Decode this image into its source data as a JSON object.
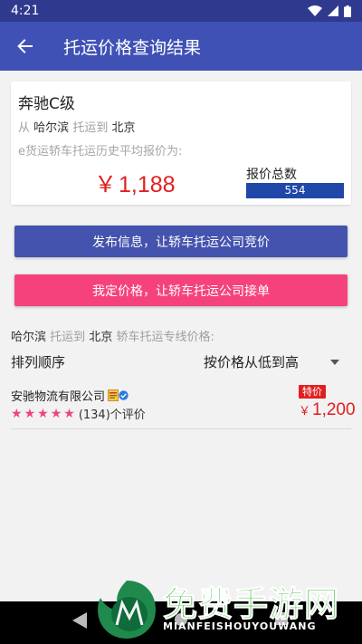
{
  "status_bar": {
    "time": "4:21"
  },
  "app_bar": {
    "title": "托运价格查询结果"
  },
  "summary": {
    "car_name": "奔驰C级",
    "from_prefix": "从",
    "from_city": "哈尔滨",
    "to_mid": "托运到",
    "to_city": "北京",
    "history_label": "e货运轿车托运历史平均报价为:",
    "currency": "￥",
    "avg_price": "1,188",
    "total_label": "报价总数",
    "total_count": "554"
  },
  "actions": {
    "publish_label": "发布信息，让轿车托运公司竞价",
    "fixed_label": "我定价格，让轿车托运公司接单"
  },
  "line_section": {
    "from_city": "哈尔滨",
    "mid": "托运到",
    "to_city": "北京",
    "suffix": "轿车托运专线价格:"
  },
  "sort": {
    "label": "排列顺序",
    "selected": "按价格从低到高"
  },
  "companies": [
    {
      "name": "安驰物流有限公司",
      "stars": 5,
      "reviews": "(134)个评价",
      "tag": "特价",
      "currency": "￥",
      "price": "1,200"
    }
  ],
  "watermark": {
    "title": "免费手游网",
    "subtitle": "MIANFEISHOUYOUWANG"
  },
  "colors": {
    "primary": "#3f51b5",
    "status_bar": "#2f3a8f",
    "publish_button": "#4453ad",
    "fixed_button": "#f5427d",
    "price_red": "#e02020",
    "count_bar": "#1f47a8",
    "star_pink": "#f0427b"
  },
  "icons": {
    "back": "arrow-left-icon",
    "wifi": "wifi-icon",
    "signal": "signal-icon",
    "battery": "battery-icon",
    "dropdown": "triangle-down-icon",
    "verified": "verified-badge-icon",
    "license": "license-badge-icon"
  }
}
